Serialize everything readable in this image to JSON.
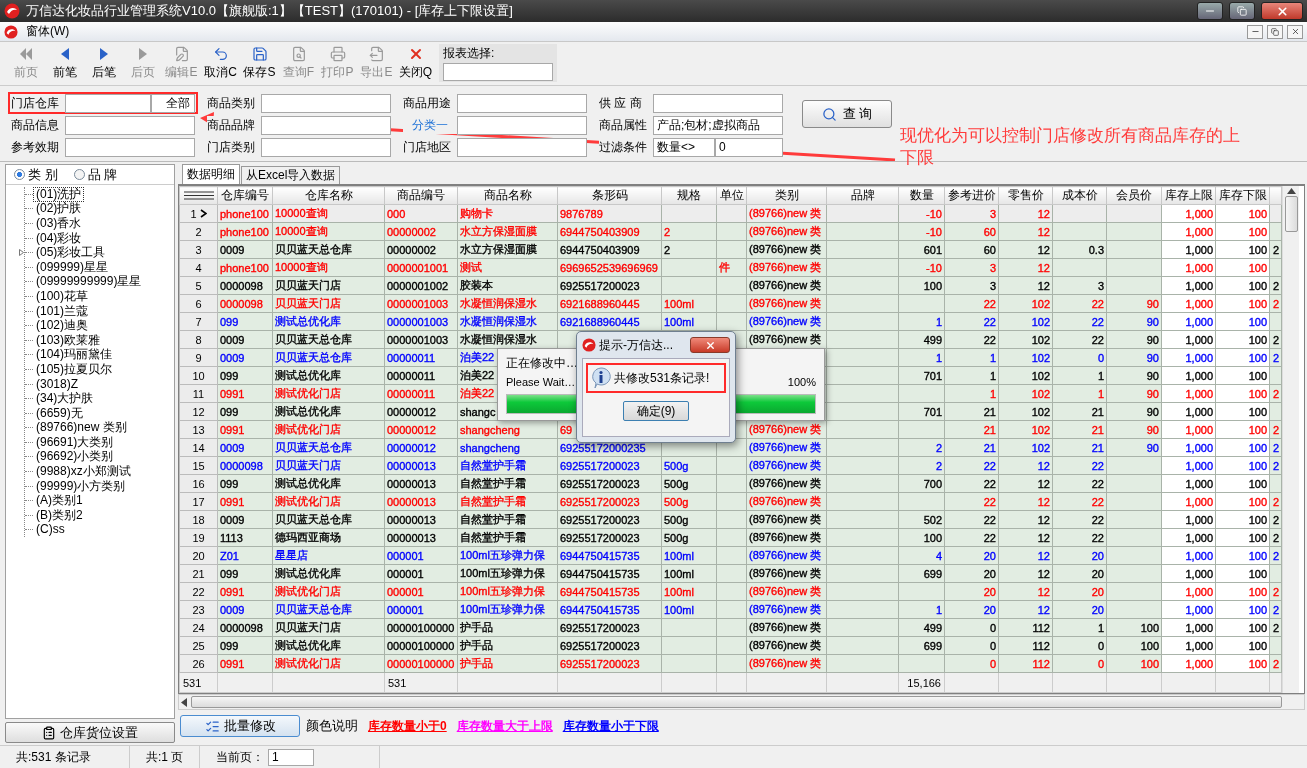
{
  "window": {
    "title": "万信达化妆品行业管理系统V10.0【旗舰版:1】【TEST】(170101) - [库存上下限设置]"
  },
  "menu": [
    "窗体(W)"
  ],
  "toolbar": [
    {
      "label": "前页",
      "disabled": true
    },
    {
      "label": "前笔",
      "disabled": false
    },
    {
      "label": "后笔",
      "disabled": false
    },
    {
      "label": "后页",
      "disabled": true
    },
    {
      "label": "编辑E",
      "disabled": true
    },
    {
      "label": "取消C",
      "disabled": false
    },
    {
      "label": "保存S",
      "disabled": false
    },
    {
      "label": "查询F",
      "disabled": true
    },
    {
      "label": "打印P",
      "disabled": true
    },
    {
      "label": "导出E",
      "disabled": true
    },
    {
      "label": "关闭Q",
      "disabled": false
    }
  ],
  "report_select": {
    "label": "报表选择:"
  },
  "filters": [
    [
      {
        "label": "门店仓库",
        "button": "全部",
        "highlighted": true,
        "kind": "field"
      },
      {
        "label": "商品类别",
        "highlighted": false,
        "kind": "field"
      },
      {
        "label": "商品用途",
        "highlighted": false,
        "kind": "field"
      },
      {
        "label": "供 应 商",
        "highlighted": false,
        "kind": "field"
      }
    ],
    [
      {
        "label": "商品信息",
        "highlighted": false,
        "kind": "field"
      },
      {
        "label": "商品品牌",
        "highlighted": false,
        "kind": "field"
      },
      {
        "label": "分类一",
        "highlighted": false,
        "kind": "link"
      },
      {
        "label": "商品属性",
        "values": [
          "产品;包材;虚拟商品"
        ],
        "highlighted": false,
        "kind": "field"
      }
    ],
    [
      {
        "label": "参考效期",
        "highlighted": false,
        "kind": "field"
      },
      {
        "label": "门店类别",
        "highlighted": false,
        "kind": "field"
      },
      {
        "label": "门店地区",
        "highlighted": false,
        "kind": "field"
      },
      {
        "label": "过滤条件",
        "values": [
          "数量<>",
          "0"
        ],
        "highlighted": false,
        "kind": "field"
      }
    ]
  ],
  "query_button": "查 询",
  "annotation": {
    "text": "现优化为可以控制门店修改所有商品库存的上下限"
  },
  "view_options": [
    {
      "label": "类 别",
      "selected": true
    },
    {
      "label": "品 牌",
      "selected": false
    }
  ],
  "tree": [
    {
      "label": "(01)洗护",
      "selected": true,
      "expandable": false
    },
    {
      "label": "(02)护肤",
      "selected": false,
      "expandable": false
    },
    {
      "label": "(03)香水",
      "selected": false,
      "expandable": false
    },
    {
      "label": "(04)彩妆",
      "selected": false,
      "expandable": false
    },
    {
      "label": "(05)彩妆工具",
      "selected": false,
      "expandable": true
    },
    {
      "label": "(099999)星星",
      "selected": false,
      "expandable": false
    },
    {
      "label": "(09999999999)星星",
      "selected": false,
      "expandable": false
    },
    {
      "label": "(100)花草",
      "selected": false,
      "expandable": false
    },
    {
      "label": "(101)兰蔻",
      "selected": false,
      "expandable": false
    },
    {
      "label": "(102)迪奥",
      "selected": false,
      "expandable": false
    },
    {
      "label": "(103)欧莱雅",
      "selected": false,
      "expandable": false
    },
    {
      "label": "(104)玛丽黛佳",
      "selected": false,
      "expandable": false
    },
    {
      "label": "(105)拉夏贝尔",
      "selected": false,
      "expandable": false
    },
    {
      "label": "(3018)Z",
      "selected": false,
      "expandable": false
    },
    {
      "label": "(34)大护肤",
      "selected": false,
      "expandable": false
    },
    {
      "label": "(6659)无",
      "selected": false,
      "expandable": false
    },
    {
      "label": "(89766)new 类别",
      "selected": false,
      "expandable": false
    },
    {
      "label": "(96691)大类别",
      "selected": false,
      "expandable": false
    },
    {
      "label": "(96692)小类别",
      "selected": false,
      "expandable": false
    },
    {
      "label": "(9988)xz小郑测试",
      "selected": false,
      "expandable": false
    },
    {
      "label": "(99999)小方类别",
      "selected": false,
      "expandable": false
    },
    {
      "label": "(A)类别1",
      "selected": false,
      "expandable": false
    },
    {
      "label": "(B)类别2",
      "selected": false,
      "expandable": false
    },
    {
      "label": "(C)ss",
      "selected": false,
      "expandable": false
    }
  ],
  "left_button": "仓库货位设置",
  "tabs": [
    {
      "label": "数据明细",
      "selected": true
    },
    {
      "label": "从Excel导入数据",
      "selected": false
    }
  ],
  "table": {
    "columns": [
      "仓库编号",
      "仓库名称",
      "商品编号",
      "商品名称",
      "条形码",
      "规格",
      "单位",
      "类别",
      "品牌",
      "数量",
      "参考进价",
      "零售价",
      "成本价",
      "会员价",
      "库存上限",
      "库存下限",
      null
    ],
    "rows": [
      {
        "index": "1",
        "selected": true,
        "color": "#ff0000",
        "cells": [
          "phone100",
          "10000查询",
          "000",
          "购物卡",
          "9876789",
          null,
          null,
          "(89766)new 类",
          null,
          "-10",
          "3",
          "12",
          null,
          null,
          "1,000",
          "100",
          null
        ]
      },
      {
        "index": "2",
        "selected": false,
        "color": "#ff0000",
        "cells": [
          "phone100",
          "10000查询",
          "00000002",
          "水立方保湿面膜",
          "6944750403909",
          "2",
          null,
          "(89766)new 类",
          null,
          "-10",
          "60",
          "12",
          null,
          null,
          "1,000",
          "100",
          null
        ]
      },
      {
        "index": "3",
        "selected": false,
        "color": "#000000",
        "cells": [
          "0009",
          "贝贝蓝天总仓库",
          "00000002",
          "水立方保湿面膜",
          "6944750403909",
          "2",
          null,
          "(89766)new 类",
          null,
          "601",
          "60",
          "12",
          "0.3",
          null,
          "1,000",
          "100",
          "2"
        ]
      },
      {
        "index": "4",
        "selected": false,
        "color": "#ff0000",
        "cells": [
          "phone100",
          "10000查询",
          "0000001001",
          "测试",
          "6969652539696969",
          null,
          "件",
          "(89766)new 类",
          null,
          "-10",
          "3",
          "12",
          null,
          null,
          "1,000",
          "100",
          null
        ]
      },
      {
        "index": "5",
        "selected": false,
        "color": "#000000",
        "cells": [
          "0000098",
          "贝贝蓝天门店",
          "0000001002",
          "胶装本",
          "6925517200023",
          null,
          null,
          "(89766)new 类",
          null,
          "100",
          "3",
          "12",
          "3",
          null,
          "1,000",
          "100",
          "2"
        ]
      },
      {
        "index": "6",
        "selected": false,
        "color": "#ff0000",
        "cells": [
          "0000098",
          "贝贝蓝天门店",
          "0000001003",
          "水凝恒润保湿水",
          "6921688960445",
          "100ml",
          null,
          "(89766)new 类",
          null,
          null,
          "22",
          "102",
          "22",
          "90",
          "1,000",
          "100",
          "2"
        ]
      },
      {
        "index": "7",
        "selected": false,
        "color": "#0000ff",
        "cells": [
          "099",
          "测试总优化库",
          "0000001003",
          "水凝恒润保湿水",
          "6921688960445",
          "100ml",
          null,
          "(89766)new 类",
          null,
          "1",
          "22",
          "102",
          "22",
          "90",
          "1,000",
          "100",
          null
        ]
      },
      {
        "index": "8",
        "selected": false,
        "color": "#000000",
        "cells": [
          "0009",
          "贝贝蓝天总仓库",
          "0000001003",
          "水凝恒润保湿水",
          null,
          null,
          null,
          "(89766)new 类",
          null,
          "499",
          "22",
          "102",
          "22",
          "90",
          "1,000",
          "100",
          "2"
        ]
      },
      {
        "index": "9",
        "selected": false,
        "color": "#0000ff",
        "cells": [
          "0009",
          "贝贝蓝天总仓库",
          "00000011",
          "泊美22",
          null,
          null,
          null,
          null,
          null,
          "1",
          "1",
          "102",
          "0",
          "90",
          "1,000",
          "100",
          "2"
        ]
      },
      {
        "index": "10",
        "selected": false,
        "color": "#000000",
        "cells": [
          "099",
          "测试总优化库",
          "00000011",
          "泊美22",
          null,
          null,
          null,
          null,
          null,
          "701",
          "1",
          "102",
          "1",
          "90",
          "1,000",
          "100",
          null
        ]
      },
      {
        "index": "11",
        "selected": false,
        "color": "#ff0000",
        "cells": [
          "0991",
          "测试优化门店",
          "00000011",
          "泊美22",
          null,
          null,
          null,
          null,
          null,
          null,
          "1",
          "102",
          "1",
          "90",
          "1,000",
          "100",
          "2"
        ]
      },
      {
        "index": "12",
        "selected": false,
        "color": "#000000",
        "cells": [
          "099",
          "测试总优化库",
          "00000012",
          "shangc",
          null,
          null,
          null,
          null,
          null,
          "701",
          "21",
          "102",
          "21",
          "90",
          "1,000",
          "100",
          null
        ]
      },
      {
        "index": "13",
        "selected": false,
        "color": "#ff0000",
        "cells": [
          "0991",
          "测试优化门店",
          "00000012",
          "shangcheng",
          "69",
          null,
          null,
          "(89766)new 类",
          null,
          null,
          "21",
          "102",
          "21",
          "90",
          "1,000",
          "100",
          "2"
        ]
      },
      {
        "index": "14",
        "selected": false,
        "color": "#0000ff",
        "cells": [
          "0009",
          "贝贝蓝天总仓库",
          "00000012",
          "shangcheng",
          "69255172000235",
          null,
          null,
          "(89766)new 类",
          null,
          "2",
          "21",
          "102",
          "21",
          "90",
          "1,000",
          "100",
          "2"
        ]
      },
      {
        "index": "15",
        "selected": false,
        "color": "#0000ff",
        "cells": [
          "0000098",
          "贝贝蓝天门店",
          "00000013",
          "自然堂护手霜",
          "6925517200023",
          "500g",
          null,
          "(89766)new 类",
          null,
          "2",
          "22",
          "12",
          "22",
          null,
          "1,000",
          "100",
          "2"
        ]
      },
      {
        "index": "16",
        "selected": false,
        "color": "#000000",
        "cells": [
          "099",
          "测试总优化库",
          "00000013",
          "自然堂护手霜",
          "6925517200023",
          "500g",
          null,
          "(89766)new 类",
          null,
          "700",
          "22",
          "12",
          "22",
          null,
          "1,000",
          "100",
          null
        ]
      },
      {
        "index": "17",
        "selected": false,
        "color": "#ff0000",
        "cells": [
          "0991",
          "测试优化门店",
          "00000013",
          "自然堂护手霜",
          "6925517200023",
          "500g",
          null,
          "(89766)new 类",
          null,
          null,
          "22",
          "12",
          "22",
          null,
          "1,000",
          "100",
          "2"
        ]
      },
      {
        "index": "18",
        "selected": false,
        "color": "#000000",
        "cells": [
          "0009",
          "贝贝蓝天总仓库",
          "00000013",
          "自然堂护手霜",
          "6925517200023",
          "500g",
          null,
          "(89766)new 类",
          null,
          "502",
          "22",
          "12",
          "22",
          null,
          "1,000",
          "100",
          "2"
        ]
      },
      {
        "index": "19",
        "selected": false,
        "color": "#000000",
        "cells": [
          "1113",
          "德玛西亚商场",
          "00000013",
          "自然堂护手霜",
          "6925517200023",
          "500g",
          null,
          "(89766)new 类",
          null,
          "100",
          "22",
          "12",
          "22",
          null,
          "1,000",
          "100",
          "2"
        ]
      },
      {
        "index": "20",
        "selected": false,
        "color": "#0000ff",
        "cells": [
          "Z01",
          "星星店",
          "000001",
          "100ml五珍弹力保",
          "6944750415735",
          "100ml",
          null,
          "(89766)new 类",
          null,
          "4",
          "20",
          "12",
          "20",
          null,
          "1,000",
          "100",
          "2"
        ]
      },
      {
        "index": "21",
        "selected": false,
        "color": "#000000",
        "cells": [
          "099",
          "测试总优化库",
          "000001",
          "100ml五珍弹力保",
          "6944750415735",
          "100ml",
          null,
          "(89766)new 类",
          null,
          "699",
          "20",
          "12",
          "20",
          null,
          "1,000",
          "100",
          null
        ]
      },
      {
        "index": "22",
        "selected": false,
        "color": "#ff0000",
        "cells": [
          "0991",
          "测试优化门店",
          "000001",
          "100ml五珍弹力保",
          "6944750415735",
          "100ml",
          null,
          "(89766)new 类",
          null,
          null,
          "20",
          "12",
          "20",
          null,
          "1,000",
          "100",
          "2"
        ]
      },
      {
        "index": "23",
        "selected": false,
        "color": "#0000ff",
        "cells": [
          "0009",
          "贝贝蓝天总仓库",
          "000001",
          "100ml五珍弹力保",
          "6944750415735",
          "100ml",
          null,
          "(89766)new 类",
          null,
          "1",
          "20",
          "12",
          "20",
          null,
          "1,000",
          "100",
          "2"
        ]
      },
      {
        "index": "24",
        "selected": false,
        "color": "#000000",
        "cells": [
          "0000098",
          "贝贝蓝天门店",
          "00000100000",
          "护手品",
          "6925517200023",
          null,
          null,
          "(89766)new 类",
          null,
          "499",
          "0",
          "112",
          "1",
          "100",
          "1,000",
          "100",
          "2"
        ]
      },
      {
        "index": "25",
        "selected": false,
        "color": "#000000",
        "cells": [
          "099",
          "测试总优化库",
          "00000100000",
          "护手品",
          "6925517200023",
          null,
          null,
          "(89766)new 类",
          null,
          "699",
          "0",
          "112",
          "0",
          "100",
          "1,000",
          "100",
          null
        ]
      },
      {
        "index": "26",
        "selected": false,
        "color": "#ff0000",
        "cells": [
          "0991",
          "测试优化门店",
          "00000100000",
          "护手品",
          "6925517200023",
          null,
          null,
          "(89766)new 类",
          null,
          null,
          "0",
          "112",
          "0",
          "100",
          "1,000",
          "100",
          "2"
        ]
      }
    ],
    "footer": {
      "index": "531",
      "cells": [
        null,
        null,
        "531",
        null,
        null,
        null,
        null,
        null,
        null,
        "15,166",
        null,
        null,
        null,
        null,
        null,
        null,
        null
      ]
    }
  },
  "batch_button": "批量修改",
  "legend_label": "颜色说明",
  "legend": [
    {
      "label": "库存数量小于0",
      "color": "#ff0000"
    },
    {
      "label": "库存数量大于上限",
      "color": "#ff00ff"
    },
    {
      "label": "库存数量小于下限",
      "color": "#0000ff"
    }
  ],
  "status_bar": {
    "records": "共:531 条记录",
    "pages": "共:1 页",
    "current_label": "当前页：",
    "current_value": "1"
  },
  "progress_dialog": {
    "title": "正在修改中…",
    "subtitle": "Please Wait…",
    "percent": "100%",
    "level": 1
  },
  "message_dialog": {
    "title": "提示-万信达...",
    "message": "共修改531条记录!",
    "button": "确定(9)",
    "highlighted": true
  }
}
